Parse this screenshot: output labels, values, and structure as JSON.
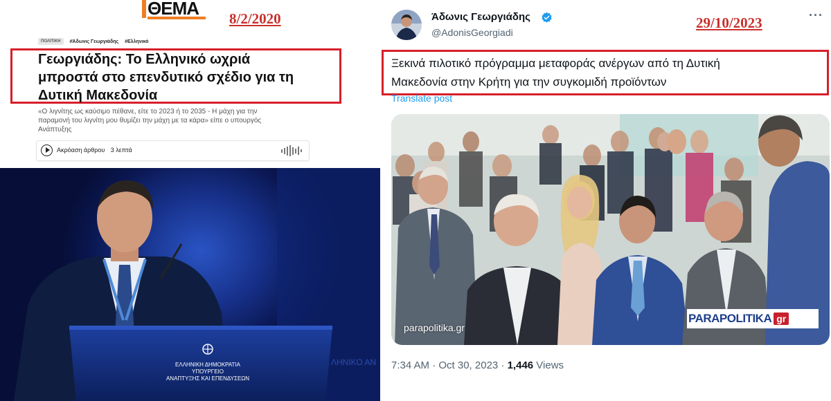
{
  "left": {
    "logo": {
      "text": "ΘΕΜΑ",
      "brand_color": "#ef7d22"
    },
    "date": "8/2/2020",
    "tags": {
      "category": "ΠΟΛΙΤΙΚΗ",
      "tag1": "#Άδωνις Γεωργιάδης",
      "tag2": "#Ελληνικό"
    },
    "headline_line1": "Γεωργιάδης: Το Ελληνικό ωχριά",
    "headline_line2": "μπροστά στο επενδυτικό σχέδιο για τη",
    "headline_line3": "Δυτική Μακεδονία",
    "lede_line1": "«Ο λιγνίτης ως καύσιμο πέθανε, είτε το 2023 ή το 2035 - Η μάχη για την",
    "lede_line2": "παραμονή του λιγνίτη μου θυμίζει την μάχη με τα κάρα» είπε ο υπουργός",
    "lede_line3": "Ανάπτυξης",
    "audio": {
      "label": "Ακρόαση άρθρου",
      "duration": "3 λεπτά",
      "play_icon": "play-icon",
      "wave_icon": "waveform-icon"
    },
    "podium": {
      "line1": "ΕΛΛΗΝΙΚΗ ΔΗΜΟΚΡΑΤΙΑ",
      "line2": "ΥΠΟΥΡΓΕΙΟ",
      "line3": "ΑΝΑΠΤΥΞΗΣ ΚΑΙ ΕΠΕΝΔΥΣΕΩΝ",
      "backdrop_fragment": "ΛΗΝΙΚΟ ΑΝ"
    },
    "highlight_color": "#d81e2a"
  },
  "right": {
    "date": "29/10/2023",
    "display_name": "Άδωνις Γεωργιάδης",
    "handle": "@AdonisGeorgiadi",
    "verified_icon": "verified-badge-icon",
    "more_icon": "more-options-icon",
    "more_text": "···",
    "tweet_line1": "Ξεκινά πιλοτικό πρόγραμμα μεταφοράς ανέργων από τη Δυτική",
    "tweet_line2": "Μακεδονία στην Κρήτη για την συγκομιδή προϊόντων",
    "translate": "Translate post",
    "watermark_left": "parapolitika.gr",
    "watermark_right_1": "PARAPOLITIKA",
    "watermark_right_2": "gr",
    "time": "7:34 AM · Oct 30, 2023 · ",
    "views_count": "1,446",
    "views_label": " Views",
    "link_color": "#1d9bf0",
    "verified_color": "#1d9bf0"
  }
}
